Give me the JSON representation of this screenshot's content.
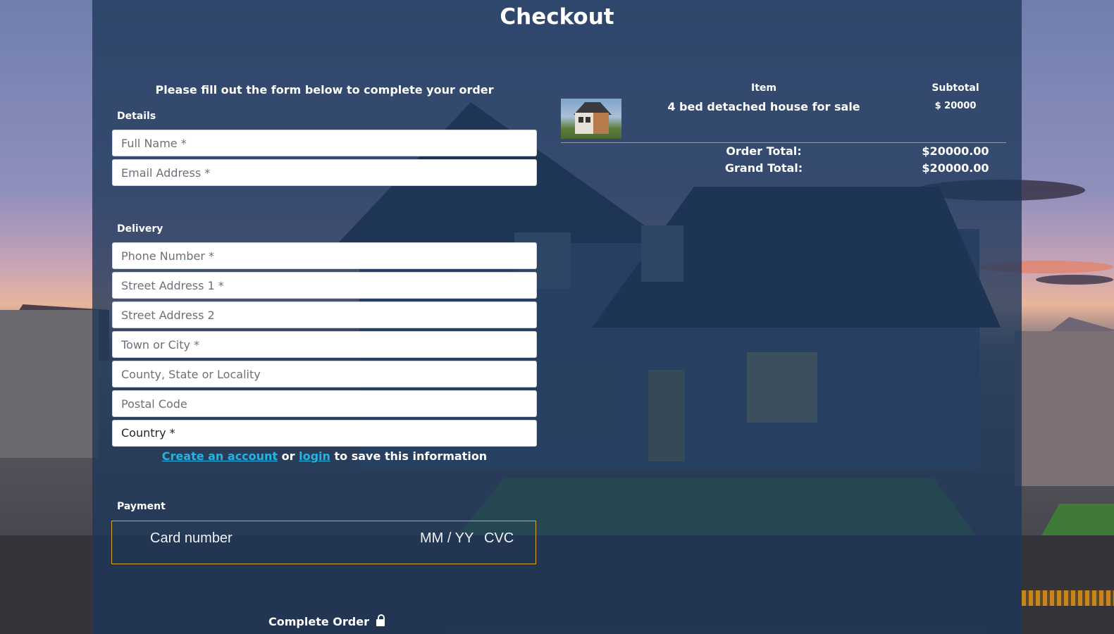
{
  "page": {
    "title": "Checkout",
    "intro": "Please fill out the form below to complete your order"
  },
  "details": {
    "label": "Details",
    "full_name_placeholder": "Full Name *",
    "email_placeholder": "Email Address *"
  },
  "delivery": {
    "label": "Delivery",
    "phone_placeholder": "Phone Number *",
    "street1_placeholder": "Street Address 1 *",
    "street2_placeholder": "Street Address 2",
    "town_placeholder": "Town or City *",
    "county_placeholder": "County, State or Locality",
    "postcode_placeholder": "Postal Code",
    "country_value": "Country *"
  },
  "account": {
    "create_link": "Create an account",
    "or_text": " or ",
    "login_link": "login",
    "suffix": " to save this information"
  },
  "payment": {
    "label": "Payment",
    "card_number_placeholder": "Card number",
    "expiry_placeholder": "MM / YY",
    "cvc_placeholder": "CVC"
  },
  "submit": {
    "label": "Complete Order",
    "icon": "lock-icon"
  },
  "order": {
    "col_item": "Item",
    "col_subtotal": "Subtotal",
    "items": [
      {
        "name": "4 bed detached house for sale",
        "price": "$ 20000"
      }
    ],
    "order_total_label": "Order Total:",
    "order_total_value": "$20000.00",
    "grand_total_label": "Grand Total:",
    "grand_total_value": "$20000.00"
  },
  "colors": {
    "panel_overlay": "#1e375a",
    "link": "#1fb6e6",
    "card_border": "#d6a72a"
  }
}
